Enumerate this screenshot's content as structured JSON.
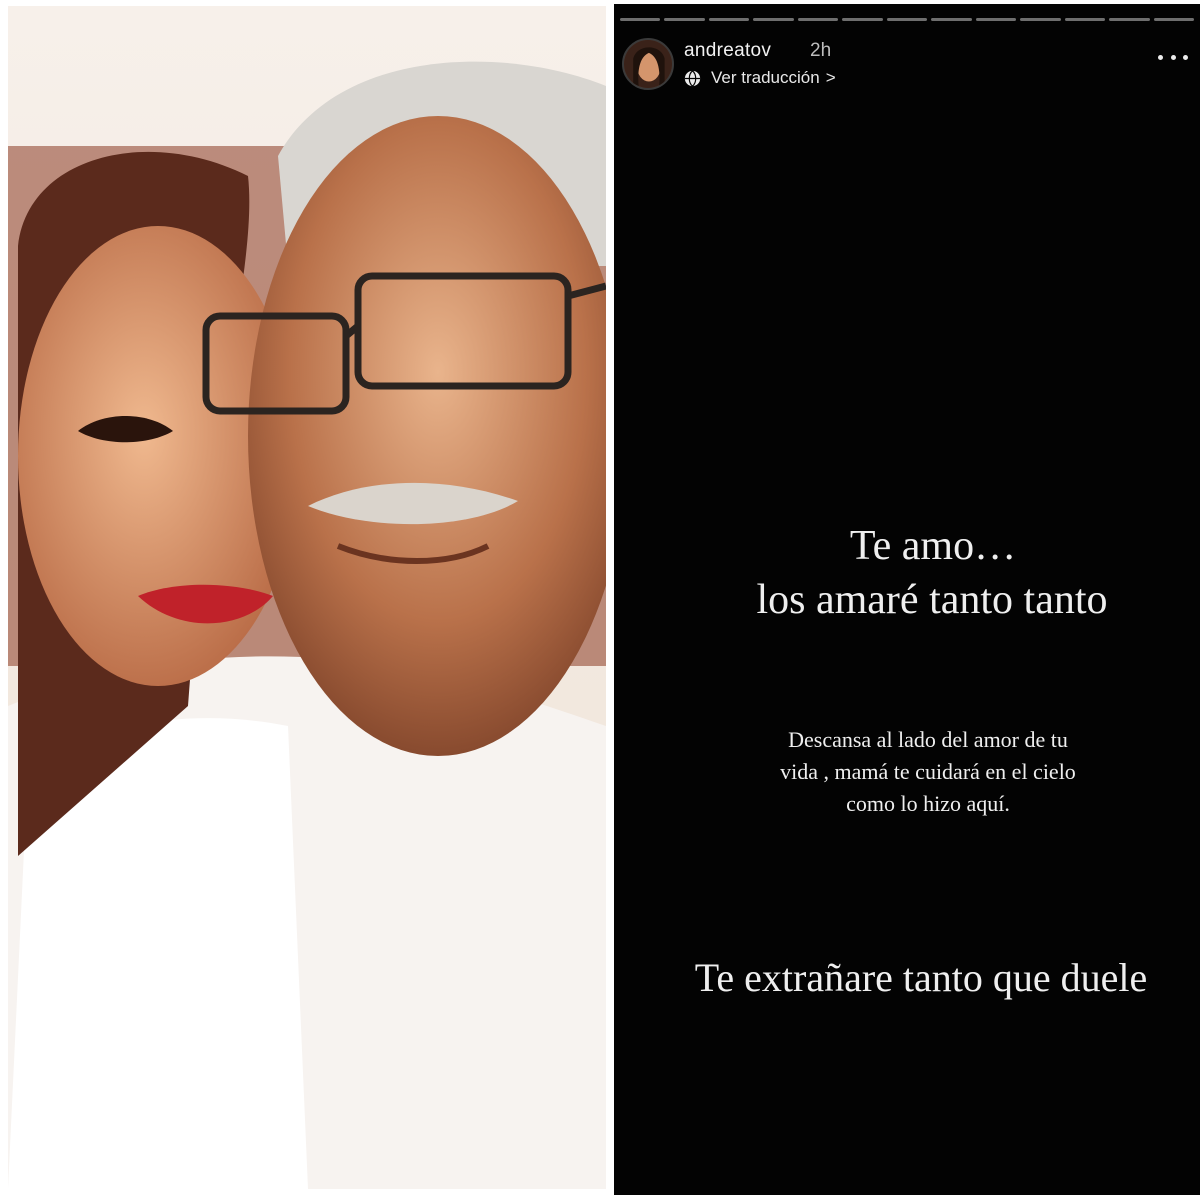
{
  "story": {
    "username": "andreatov",
    "time": "2h",
    "translate_label": "Ver traducción",
    "translate_chevron": ">",
    "progress_segments": 13,
    "text": {
      "heading_line1": "Te amo…",
      "heading_line2": "los amaré tanto tanto",
      "body_line1": "Descansa al lado del amor de tu",
      "body_line2": "vida , mamá te cuidará en el cielo",
      "body_line3": "como lo hizo aquí.",
      "closing": "Te extrañare tanto que duele"
    },
    "icons": {
      "translate": "globe-icon",
      "more": "more-options-icon"
    }
  },
  "colors": {
    "story_background": "#030303",
    "story_text": "#efefef",
    "progress_track": "#6e6e6e"
  }
}
